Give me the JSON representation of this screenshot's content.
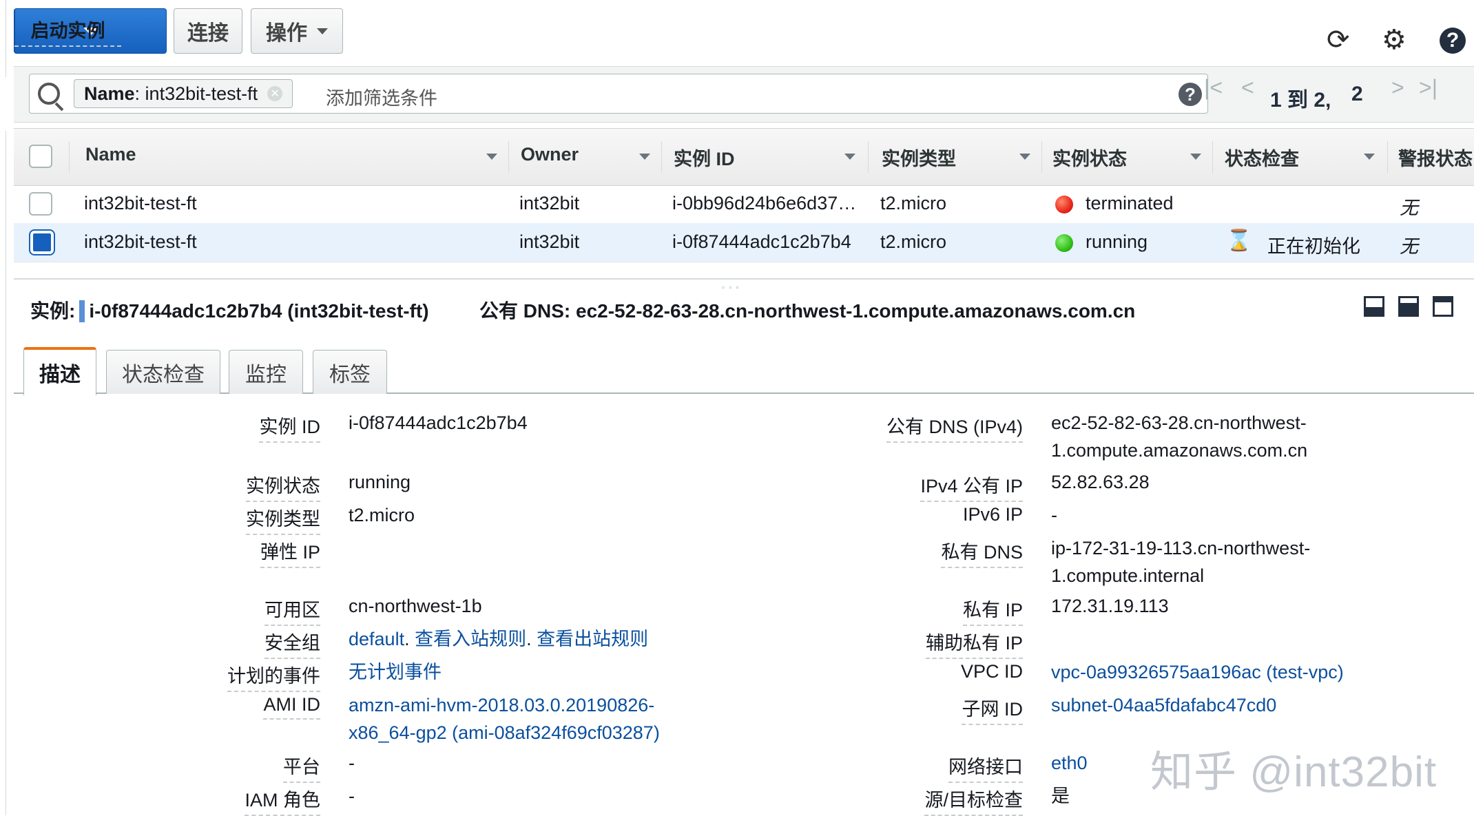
{
  "toolbar": {
    "launch_label": "启动实例",
    "connect_label": "连接",
    "actions_label": "操作"
  },
  "filter": {
    "token_key": "Name",
    "token_value": ": int32bit-test-ft",
    "placeholder": "添加筛选条件",
    "pagination_range": "1 到 2,",
    "pagination_total": "2"
  },
  "table": {
    "columns": [
      "Name",
      "Owner",
      "实例 ID",
      "实例类型",
      "实例状态",
      "状态检查",
      "警报状态"
    ],
    "rows": [
      {
        "name": "int32bit-test-ft",
        "owner": "int32bit",
        "instance_id": "i-0bb96d24b6e6d37…",
        "type": "t2.micro",
        "state": "terminated",
        "status_check": "",
        "alarm": "无",
        "selected": false
      },
      {
        "name": "int32bit-test-ft",
        "owner": "int32bit",
        "instance_id": "i-0f87444adc1c2b7b4",
        "type": "t2.micro",
        "state": "running",
        "status_check": "正在初始化",
        "alarm": "无",
        "selected": true
      }
    ]
  },
  "detail": {
    "instance_label": "实例:",
    "instance_value": "i-0f87444adc1c2b7b4 (int32bit-test-ft)",
    "dns_label": "公有 DNS:",
    "dns_value": "ec2-52-82-63-28.cn-northwest-1.compute.amazonaws.com.cn",
    "tabs": [
      "描述",
      "状态检查",
      "监控",
      "标签"
    ],
    "left": [
      {
        "label": "实例 ID",
        "value": "i-0f87444adc1c2b7b4"
      },
      {
        "label": "实例状态",
        "value": "running"
      },
      {
        "label": "实例类型",
        "value": "t2.micro"
      },
      {
        "label": "弹性 IP",
        "value": ""
      },
      {
        "label": "可用区",
        "value": "cn-northwest-1b"
      },
      {
        "label": "安全组",
        "value_link1": "default",
        "value_link2": "查看入站规则",
        "value_link3": "查看出站规则"
      },
      {
        "label": "计划的事件",
        "value": "无计划事件"
      },
      {
        "label": "AMI ID",
        "value_line1": "amzn-ami-hvm-2018.03.0.20190826-",
        "value_line2": "x86_64-gp2 (ami-08af324f69cf03287)"
      },
      {
        "label": "平台",
        "value": "-"
      },
      {
        "label": "IAM 角色",
        "value": "-"
      }
    ],
    "right": [
      {
        "label": "公有 DNS (IPv4)",
        "value_line1": "ec2-52-82-63-28.cn-northwest-",
        "value_line2": "1.compute.amazonaws.com.cn"
      },
      {
        "label": "IPv4 公有 IP",
        "value": "52.82.63.28"
      },
      {
        "label": "IPv6 IP",
        "value": "-"
      },
      {
        "label": "私有 DNS",
        "value_line1": "ip-172-31-19-113.cn-northwest-",
        "value_line2": "1.compute.internal"
      },
      {
        "label": "私有 IP",
        "value": "172.31.19.113"
      },
      {
        "label": "辅助私有 IP",
        "value": ""
      },
      {
        "label": "VPC ID",
        "value": "vpc-0a99326575aa196ac (test-vpc)"
      },
      {
        "label": "子网 ID",
        "value": "subnet-04aa5fdafabc47cd0"
      },
      {
        "label": "网络接口",
        "value": "eth0"
      },
      {
        "label": "源/目标检查",
        "value": "是"
      }
    ]
  },
  "watermark": "知乎 @int32bit",
  "colors": {
    "primary": "#1560bd",
    "link": "#0a4f9e",
    "tab_accent": "#ec7211",
    "selected_row": "#e8f2fc"
  }
}
